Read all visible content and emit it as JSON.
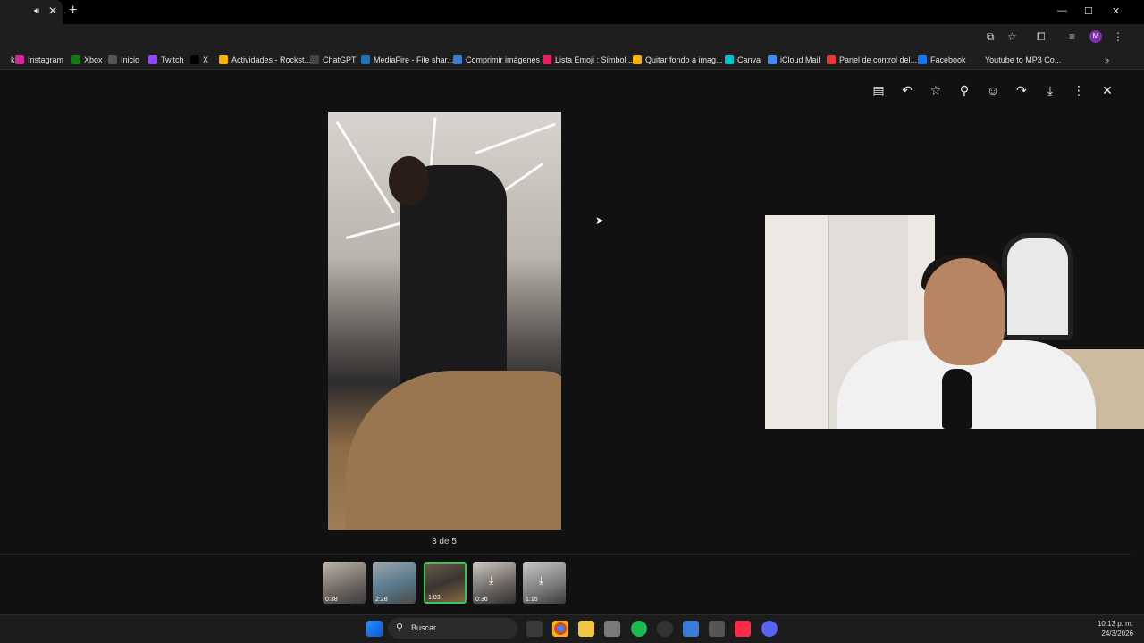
{
  "browser": {
    "tab": {
      "audio_icon": "speaker-icon",
      "close_icon": "close-icon"
    },
    "new_tab": "+",
    "window_controls": [
      "—",
      "☐",
      "✕"
    ],
    "profile_initial": "M",
    "bookmarks": [
      {
        "label": "k",
        "color": "#1e1e1e"
      },
      {
        "label": "Instagram",
        "color": "#d6249f"
      },
      {
        "label": "Xbox",
        "color": "#107c10"
      },
      {
        "label": "Inicio",
        "color": "#555555"
      },
      {
        "label": "Twitch",
        "color": "#9146ff"
      },
      {
        "label": "X",
        "color": "#000000"
      },
      {
        "label": "Actividades - Rockst...",
        "color": "#f4b400"
      },
      {
        "label": "ChatGPT",
        "color": "#444444"
      },
      {
        "label": "MediaFire - File shar...",
        "color": "#1b75bc"
      },
      {
        "label": "Comprimir imágenes",
        "color": "#3a7bd5"
      },
      {
        "label": "Lista Emoji : Símbol...",
        "color": "#e91e63"
      },
      {
        "label": "Quitar fondo a imag...",
        "color": "#f4b400"
      },
      {
        "label": "Canva",
        "color": "#00c4cc"
      },
      {
        "label": "iCloud Mail",
        "color": "#3d8bfd"
      },
      {
        "label": "Panel de control del...",
        "color": "#e53935"
      },
      {
        "label": "Facebook",
        "color": "#1877f2"
      },
      {
        "label": "Youtube to MP3 Co...",
        "color": "#1e1e1e"
      }
    ],
    "bookmarks_overflow": "»"
  },
  "viewer": {
    "actions": [
      {
        "name": "caption-icon",
        "glyph": "▤"
      },
      {
        "name": "reply-icon",
        "glyph": "↶"
      },
      {
        "name": "star-icon",
        "glyph": "☆"
      },
      {
        "name": "pin-icon",
        "glyph": "⚲"
      },
      {
        "name": "emoji-icon",
        "glyph": "☺"
      },
      {
        "name": "forward-icon",
        "glyph": "↷"
      },
      {
        "name": "download-icon",
        "glyph": "⤓"
      },
      {
        "name": "more-icon",
        "glyph": "⋮"
      },
      {
        "name": "close-icon",
        "glyph": "✕"
      }
    ],
    "counter": "3 de 5",
    "thumbnails": [
      {
        "duration": "0:38",
        "download": false,
        "active": false
      },
      {
        "duration": "2:28",
        "download": false,
        "active": false
      },
      {
        "duration": "1:03",
        "download": false,
        "active": true
      },
      {
        "duration": "0:36",
        "download": true,
        "active": false
      },
      {
        "duration": "1:15",
        "download": true,
        "active": false
      }
    ]
  },
  "taskbar": {
    "search_placeholder": "Buscar",
    "time": "10:13 p. m.",
    "date": "24/3/2026"
  }
}
